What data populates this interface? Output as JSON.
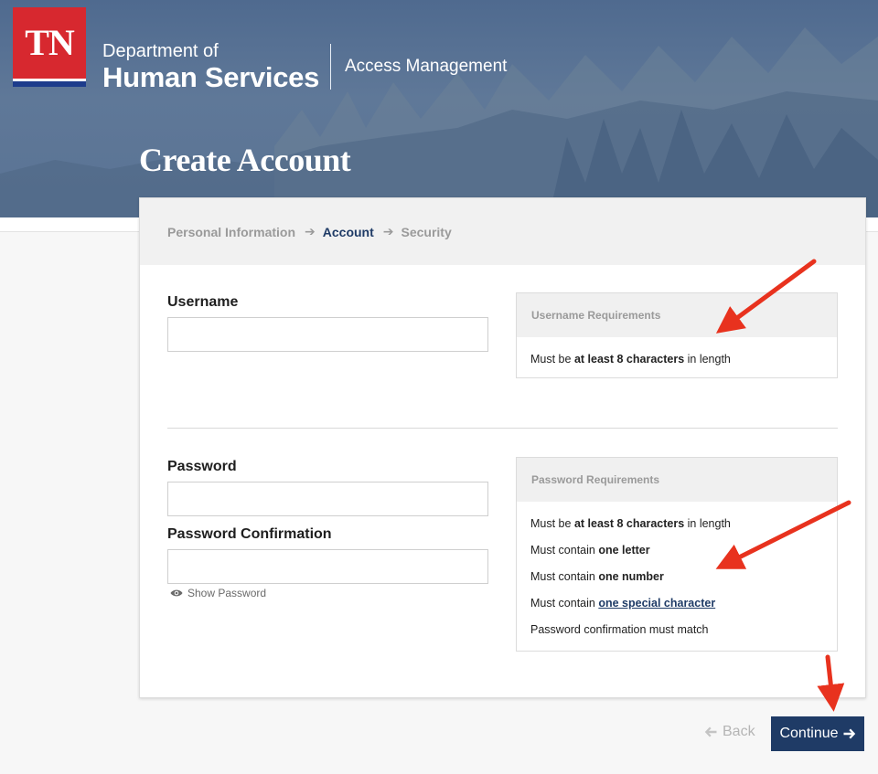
{
  "header": {
    "logo_text": "TN",
    "dept_line1": "Department of",
    "dept_line2": "Human Services",
    "app_name": "Access Management",
    "page_title": "Create Account"
  },
  "steps": [
    {
      "label": "Personal Information",
      "active": false
    },
    {
      "label": "Account",
      "active": true
    },
    {
      "label": "Security",
      "active": false
    }
  ],
  "username": {
    "label": "Username",
    "value": "",
    "requirements_title": "Username Requirements",
    "req_prefix": "Must be ",
    "req_bold": "at least 8 characters",
    "req_suffix": " in length"
  },
  "password": {
    "label": "Password",
    "value": "",
    "confirm_label": "Password Confirmation",
    "confirm_value": "",
    "show_password": "Show Password",
    "requirements_title": "Password Requirements",
    "requirements": [
      {
        "prefix": "Must be ",
        "bold": "at least 8 characters",
        "suffix": " in length"
      },
      {
        "prefix": "Must contain ",
        "bold": "one letter",
        "suffix": ""
      },
      {
        "prefix": "Must contain ",
        "bold": "one number",
        "suffix": ""
      },
      {
        "prefix": "Must contain ",
        "bold": "one special character",
        "suffix": ""
      },
      {
        "prefix": "Password confirmation must match",
        "bold": "",
        "suffix": ""
      }
    ]
  },
  "actions": {
    "back": "Back",
    "continue": "Continue"
  },
  "colors": {
    "brand_red": "#d7282f",
    "brand_navy": "#1f3b66",
    "annotation_arrow": "#e8321e"
  },
  "icons": {
    "step_arrow": "arrow-right-icon",
    "eye": "eye-icon",
    "back_arrow": "arrow-left-icon",
    "continue_arrow": "arrow-right-icon"
  }
}
